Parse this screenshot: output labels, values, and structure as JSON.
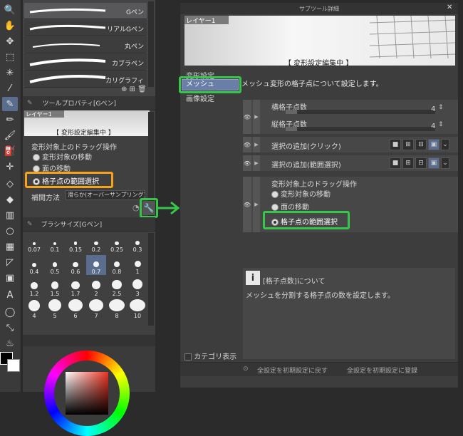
{
  "brushes": [
    {
      "name": "Gペン",
      "selected": true
    },
    {
      "name": "リアルGペン",
      "selected": false
    },
    {
      "name": "丸ペン",
      "selected": false
    },
    {
      "name": "カブラペン",
      "selected": false
    },
    {
      "name": "カリグラフィ",
      "selected": false
    }
  ],
  "tool_property": {
    "title": "ツールプロパティ[Gペン]",
    "preview_layer": "レイヤー1",
    "preview_banner": "【 変形設定編集中 】",
    "drag_label": "変形対象上のドラッグ操作",
    "opt_move": "変形対象の移動",
    "opt_face": "面の移動",
    "opt_grid": "格子点の範囲選択",
    "interp_label": "補間方法",
    "interp_value": "滑らか(オーバーサンプリング)"
  },
  "brush_size": {
    "title": "ブラシサイズ[Gペン]",
    "sizes": [
      "0.07",
      "0.1",
      "0.15",
      "0.2",
      "0.25",
      "0.3",
      "0.4",
      "0.5",
      "0.6",
      "0.7",
      "0.8",
      "1",
      "1.2",
      "1.5",
      "1.7",
      "2",
      "2.5",
      "3",
      "4",
      "5",
      "6",
      "7",
      "8",
      "10"
    ],
    "selected": "0.7"
  },
  "dialog": {
    "title": "サブツール詳細",
    "close": "✕",
    "preview_layer": "レイヤー1",
    "preview_banner": "【 変形設定編集中 】",
    "categories": [
      "変形設定",
      "メッシュ",
      "画像設定"
    ],
    "selected_category": "メッシュ",
    "description": "メッシュ変形の格子点について設定します。",
    "h_grid_label": "横格子点数",
    "h_grid_value": "4",
    "v_grid_label": "縦格子点数",
    "v_grid_value": "4",
    "add_click_label": "選択の追加(クリック)",
    "add_range_label": "選択の追加(範囲選択)",
    "drag_label": "変形対象上のドラッグ操作",
    "opt_move": "変形対象の移動",
    "opt_face": "面の移動",
    "opt_grid": "格子点の範囲選択",
    "info_title": "[格子点数]について",
    "info_text": "メッシュを分割する格子点の数を設定します。",
    "category_toggle": "カテゴリ表示",
    "reset_button": "全設定を初期設定に戻す",
    "save_button": "全設定を初期設定に登録"
  },
  "colors": {
    "highlight_green": "#35c64a",
    "highlight_orange": "#f5a31a",
    "selection_blue": "#5a6d8f"
  },
  "icons": [
    "pen-icon",
    "move-icon",
    "marquee-icon",
    "magic-wand-icon",
    "eyedropper-icon",
    "brush-icon",
    "eraser-icon",
    "fill-icon",
    "gradient-icon",
    "shape-icon",
    "text-icon",
    "lasso-icon",
    "eye-icon",
    "wrench-icon",
    "info-icon"
  ]
}
